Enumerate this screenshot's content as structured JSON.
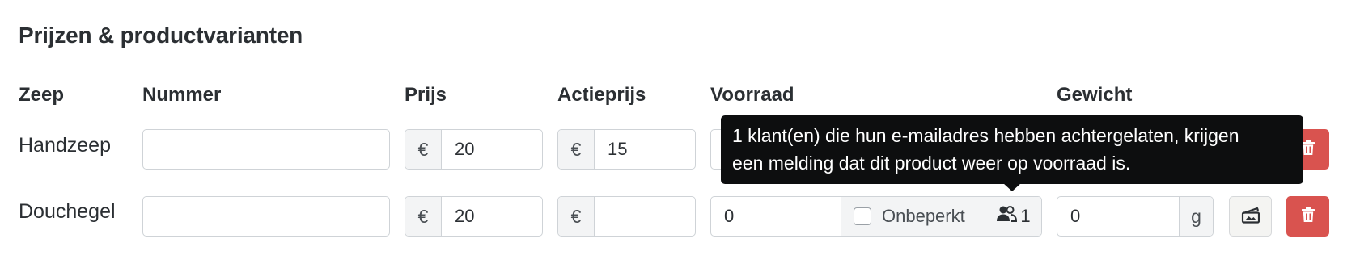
{
  "section": {
    "title": "Prijzen & productvarianten"
  },
  "headers": {
    "variant": "Zeep",
    "number": "Nummer",
    "price": "Prijs",
    "sale_price": "Actieprijs",
    "stock": "Voorraad",
    "weight": "Gewicht"
  },
  "rows": [
    {
      "label": "Handzeep",
      "number": "",
      "currency": "€",
      "price": "20",
      "sale_price": "15"
    },
    {
      "label": "Douchegel",
      "number": "",
      "currency": "€",
      "price": "20",
      "sale_price": "",
      "stock": "0",
      "unlimited_label": "Onbeperkt",
      "unlimited_checked": false,
      "notify_count": "1",
      "weight": "0",
      "weight_unit": "g"
    }
  ],
  "tooltip": {
    "line1": "1 klant(en) die hun e-mailadres hebben achtergelaten, krijgen",
    "line2": "een melding dat dit product weer op voorraad is."
  },
  "icons": {
    "notify": "users-icon",
    "image": "image-upload-icon",
    "delete": "trash-icon"
  },
  "colors": {
    "danger": "#d9534f",
    "tooltip_bg": "#0d0e0f",
    "addon_bg": "#f3f4f5",
    "text": "#2b2f33"
  }
}
